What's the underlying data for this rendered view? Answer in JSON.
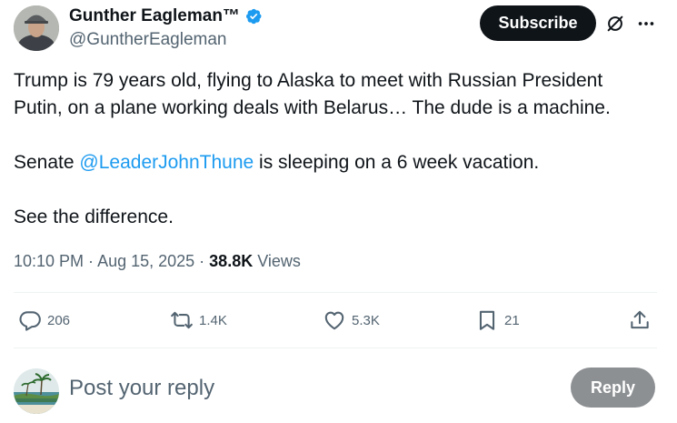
{
  "author": {
    "display_name": "Gunther Eagleman™",
    "handle": "@GuntherEagleman",
    "verified": true
  },
  "header": {
    "subscribe_label": "Subscribe",
    "grok_icon": "grok-icon",
    "more_icon": "more-icon"
  },
  "tweet": {
    "line1": "Trump is 79 years old, flying to Alaska to meet with Russian President",
    "line2": "Putin, on a plane working deals with Belarus…  The dude is a machine.",
    "line3_prefix": "Senate ",
    "line3_mention": "@LeaderJohnThune",
    "line3_suffix": " is sleeping on a 6 week vacation.",
    "line4": "See the difference."
  },
  "meta": {
    "time": "10:10 PM",
    "separator1": " · ",
    "date": "Aug 15, 2025",
    "separator2": " · ",
    "views_count": "38.8K",
    "views_label": " Views"
  },
  "actions": {
    "replies": "206",
    "reposts": "1.4K",
    "likes": "5.3K",
    "bookmarks": "21"
  },
  "reply_box": {
    "placeholder": "Post your reply",
    "button_label": "Reply"
  },
  "colors": {
    "accent": "#1d9bf0",
    "text": "#0f1419",
    "secondary": "#536471",
    "reply_button_disabled": "#8d9093"
  }
}
